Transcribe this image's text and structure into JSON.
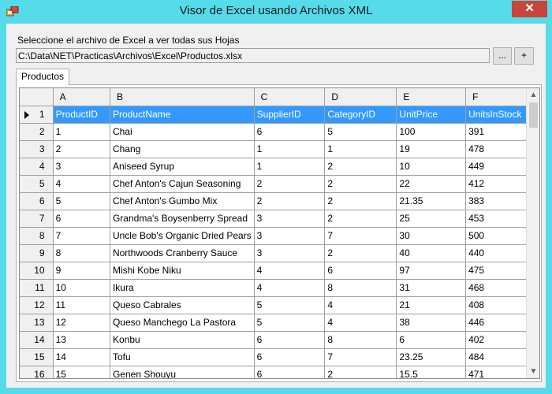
{
  "window": {
    "title": "Visor de Excel usando Archivos XML",
    "close_label": "✕"
  },
  "form": {
    "select_label": "Seleccione el archivo de Excel a ver todas sus Hojas",
    "file_path": "C:\\Data\\NET\\Practicas\\Archivos\\Excel\\Productos.xlsx",
    "browse_label": "...",
    "add_label": "+"
  },
  "tabs": [
    {
      "label": "Productos"
    }
  ],
  "grid": {
    "column_letters": [
      "A",
      "B",
      "C",
      "D",
      "E",
      "F"
    ],
    "selected_row": 1,
    "rows": [
      {
        "num": "1",
        "cells": [
          "ProductID",
          "ProductName",
          "SupplierID",
          "CategoryID",
          "UnitPrice",
          "UnitsInStock"
        ]
      },
      {
        "num": "2",
        "cells": [
          "1",
          "Chai",
          "6",
          "5",
          "100",
          "391"
        ]
      },
      {
        "num": "3",
        "cells": [
          "2",
          "Chang",
          "1",
          "1",
          "19",
          "478"
        ]
      },
      {
        "num": "4",
        "cells": [
          "3",
          "Aniseed Syrup",
          "1",
          "2",
          "10",
          "449"
        ]
      },
      {
        "num": "5",
        "cells": [
          "4",
          "Chef Anton's Cajun Seasoning",
          "2",
          "2",
          "22",
          "412"
        ]
      },
      {
        "num": "6",
        "cells": [
          "5",
          "Chef Anton's Gumbo Mix",
          "2",
          "2",
          "21.35",
          "383"
        ]
      },
      {
        "num": "7",
        "cells": [
          "6",
          "Grandma's Boysenberry Spread",
          "3",
          "2",
          "25",
          "453"
        ]
      },
      {
        "num": "8",
        "cells": [
          "7",
          "Uncle Bob's Organic Dried Pears",
          "3",
          "7",
          "30",
          "500"
        ]
      },
      {
        "num": "9",
        "cells": [
          "8",
          "Northwoods Cranberry Sauce",
          "3",
          "2",
          "40",
          "440"
        ]
      },
      {
        "num": "10",
        "cells": [
          "9",
          "Mishi Kobe Niku",
          "4",
          "6",
          "97",
          "475"
        ]
      },
      {
        "num": "11",
        "cells": [
          "10",
          "Ikura",
          "4",
          "8",
          "31",
          "468"
        ]
      },
      {
        "num": "12",
        "cells": [
          "11",
          "Queso Cabrales",
          "5",
          "4",
          "21",
          "408"
        ]
      },
      {
        "num": "13",
        "cells": [
          "12",
          "Queso Manchego La Pastora",
          "5",
          "4",
          "38",
          "446"
        ]
      },
      {
        "num": "14",
        "cells": [
          "13",
          "Konbu",
          "6",
          "8",
          "6",
          "402"
        ]
      },
      {
        "num": "15",
        "cells": [
          "14",
          "Tofu",
          "6",
          "7",
          "23.25",
          "484"
        ]
      },
      {
        "num": "16",
        "cells": [
          "15",
          "Genen Shouyu",
          "6",
          "2",
          "15.5",
          "471"
        ]
      }
    ]
  },
  "scrollbar": {
    "up_icon": "▲",
    "down_icon": "▼"
  }
}
